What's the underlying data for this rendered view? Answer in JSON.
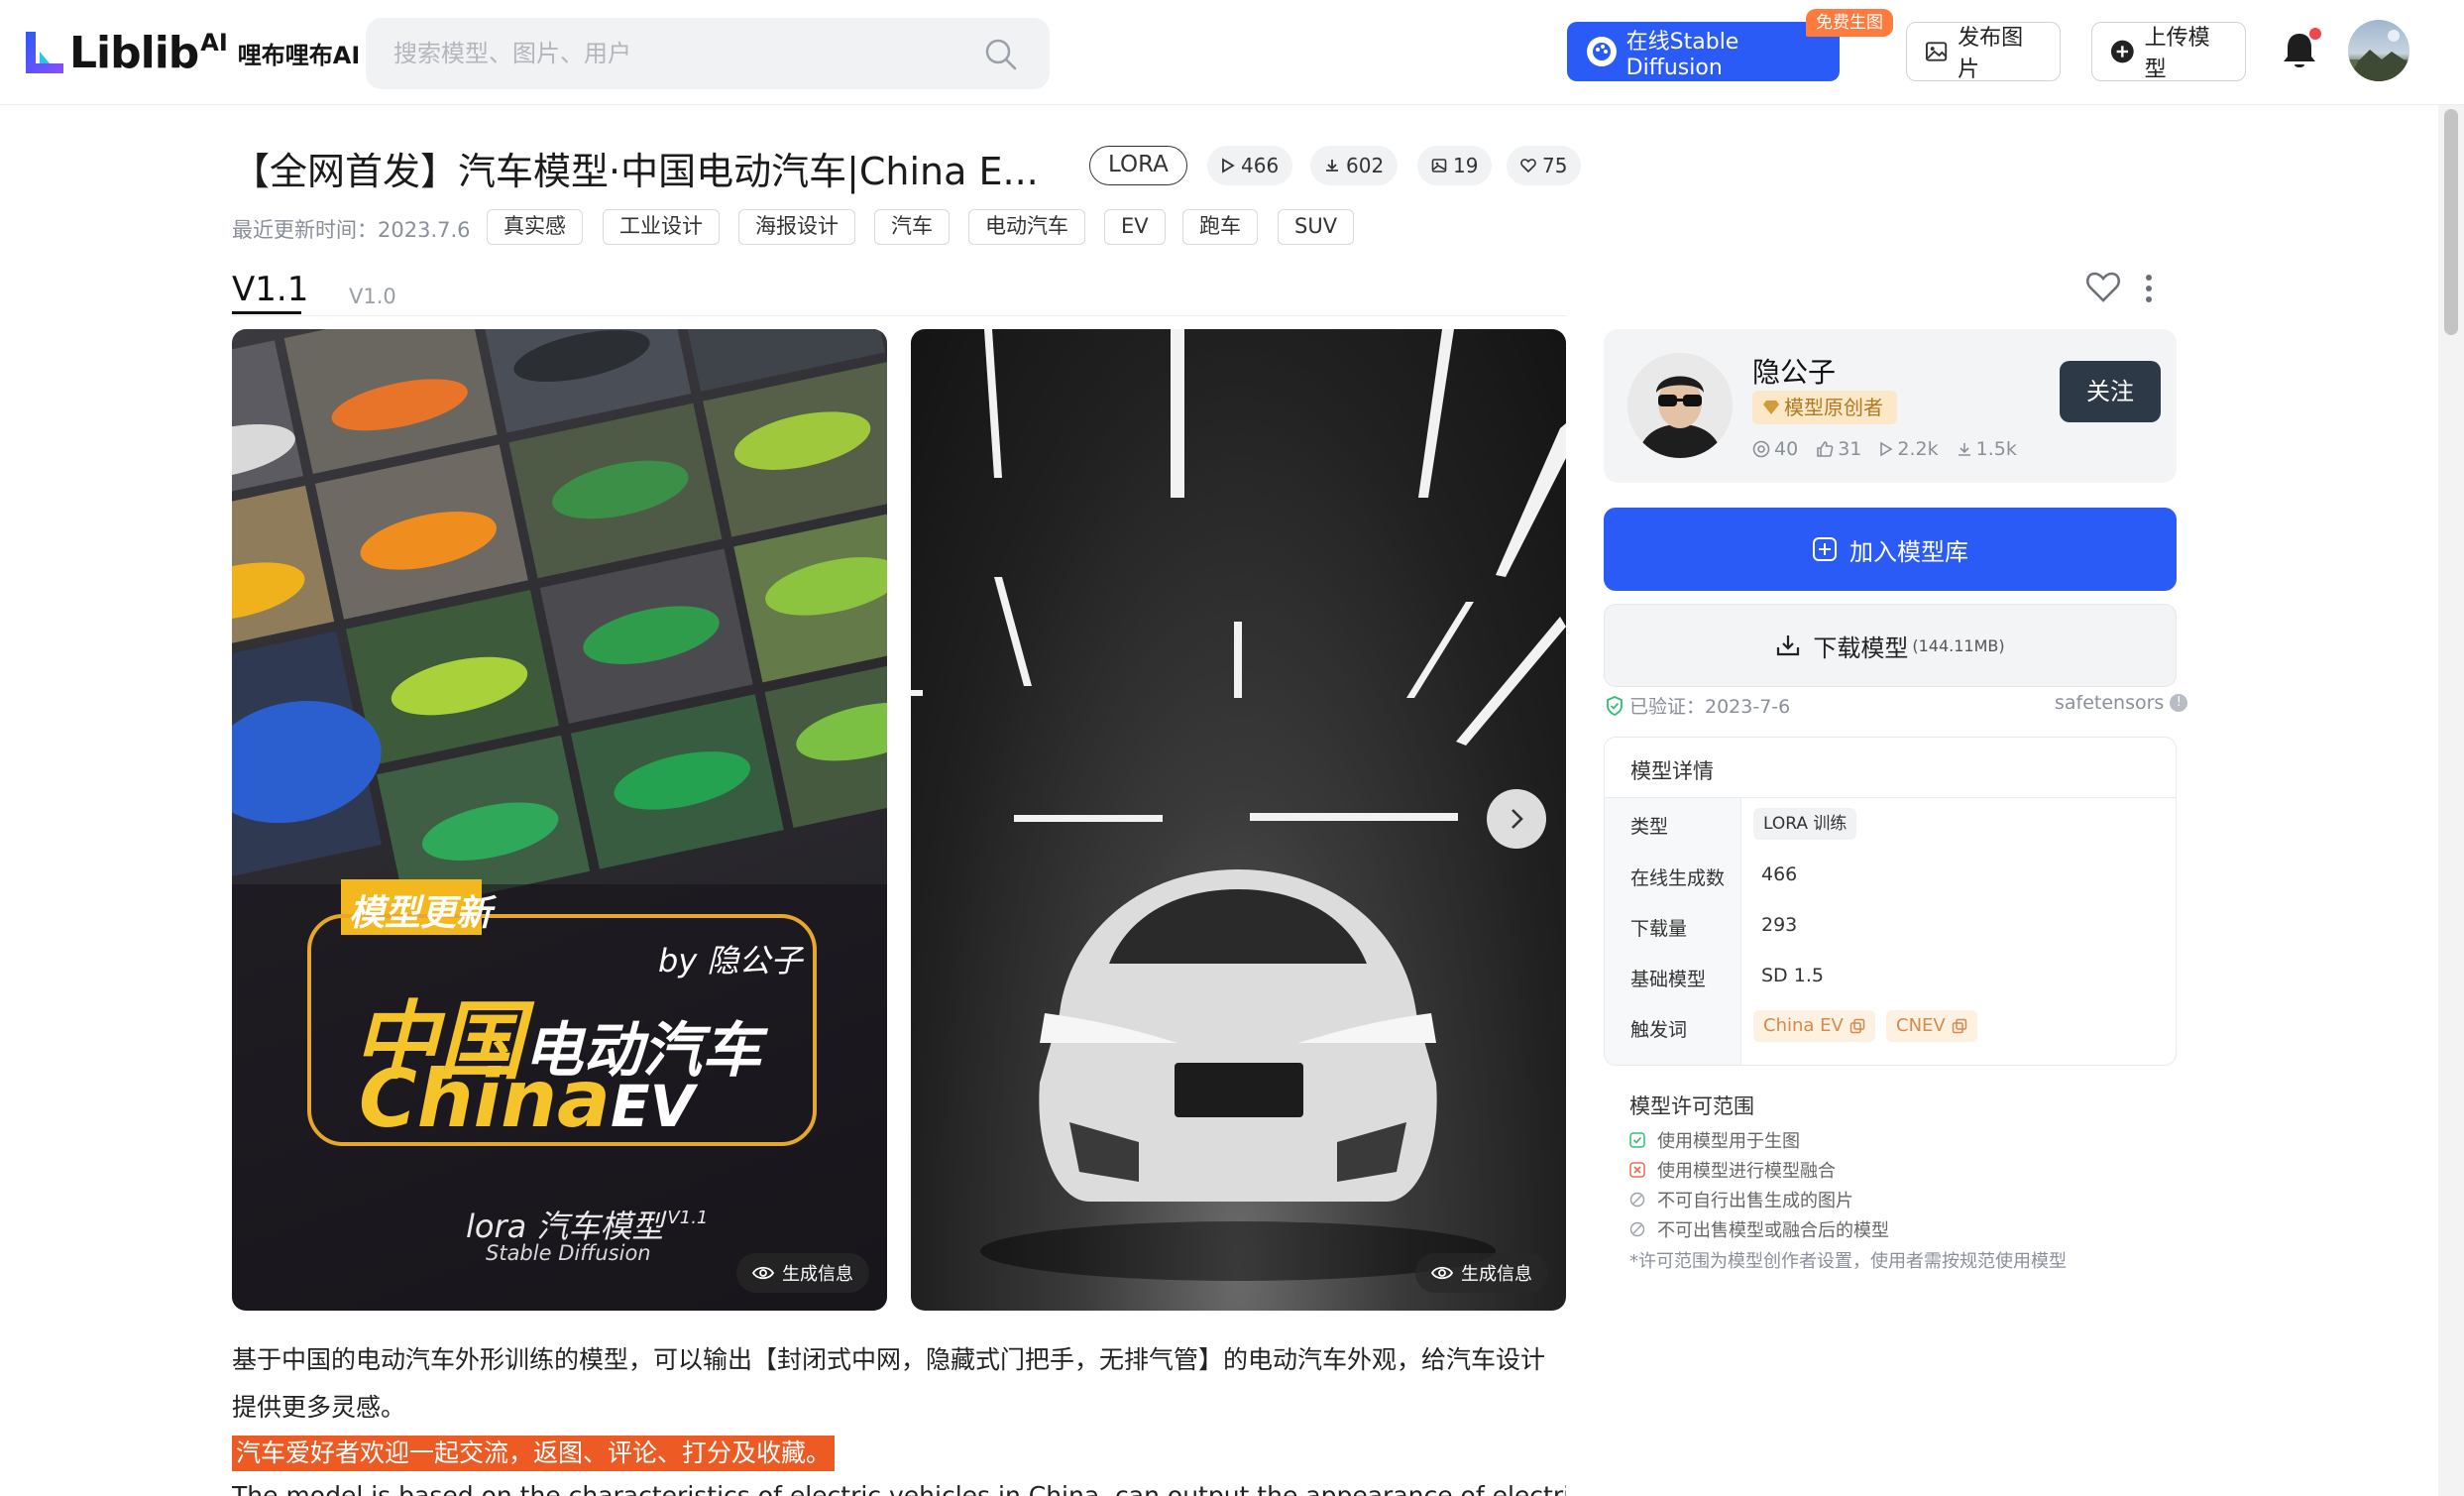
{
  "header": {
    "logo_text": "Liblib",
    "logo_ai": "AI",
    "logo_cn": "哩布哩布AI",
    "search_placeholder": "搜索模型、图片、用户",
    "sd_button": "在线Stable Diffusion",
    "free_badge": "免费生图",
    "publish_image": "发布图片",
    "upload_model": "上传模型"
  },
  "model": {
    "title": "【全网首发】汽车模型·中国电动汽车|China E...",
    "type": "LORA",
    "stats": {
      "runs": "466",
      "downloads": "602",
      "images": "19",
      "likes": "75"
    },
    "updated": "最近更新时间：2023.7.6",
    "tags": [
      "真实感",
      "工业设计",
      "海报设计",
      "汽车",
      "电动汽车",
      "EV",
      "跑车",
      "SUV"
    ],
    "versions": [
      "V1.1",
      "V1.0"
    ],
    "gen_info": "生成信息"
  },
  "poster": {
    "badge": "模型更新",
    "by": "by 隐公子",
    "line1_cn": "中国",
    "line1_rest": "电动汽车",
    "line2_a": "China",
    "line2_b": "EV",
    "footer1": "lora 汽车模型",
    "footer1_ver": "V1.1",
    "footer2": "Stable Diffusion"
  },
  "author": {
    "name": "隐公子",
    "badge": "模型原创者",
    "stats": [
      "40",
      "31",
      "2.2k",
      "1.5k"
    ],
    "follow": "关注"
  },
  "actions": {
    "add_library": "加入模型库",
    "download": "下载模型",
    "download_size": "(144.11MB)",
    "verified": "已验证：2023-7-6",
    "format": "safetensors"
  },
  "details": {
    "title": "模型详情",
    "rows": [
      {
        "label": "类型",
        "value": "LORA 训练"
      },
      {
        "label": "在线生成数",
        "value": "466"
      },
      {
        "label": "下载量",
        "value": "293"
      },
      {
        "label": "基础模型",
        "value": "SD 1.5"
      },
      {
        "label": "触发词",
        "value": ""
      }
    ],
    "triggers": [
      "China EV",
      "CNEV"
    ]
  },
  "license": {
    "title": "模型许可范围",
    "items": [
      {
        "text": "使用模型用于生图",
        "state": "allowed"
      },
      {
        "text": "使用模型进行模型融合",
        "state": "denied"
      },
      {
        "text": "不可自行出售生成的图片",
        "state": "neutral"
      },
      {
        "text": "不可出售模型或融合后的模型",
        "state": "neutral"
      }
    ],
    "note": "*许可范围为模型创作者设置，使用者需按规范使用模型"
  },
  "description": {
    "text": "基于中国的电动汽车外形训练的模型，可以输出【封闭式中网，隐藏式门把手，无排气管】的电动汽车外观，给汽车设计提供更多灵感。",
    "highlight": "汽车爱好者欢迎一起交流，返图、评论、打分及收藏。",
    "english": "The model is based on the characteristics of electric vehicles in China, can output the appearance of electric vehicles with"
  },
  "colors": {
    "primary": "#2a5bf6",
    "follow": "#2e3948",
    "highlight": "#ee5a24",
    "badge_free": "#ff7a3d"
  }
}
